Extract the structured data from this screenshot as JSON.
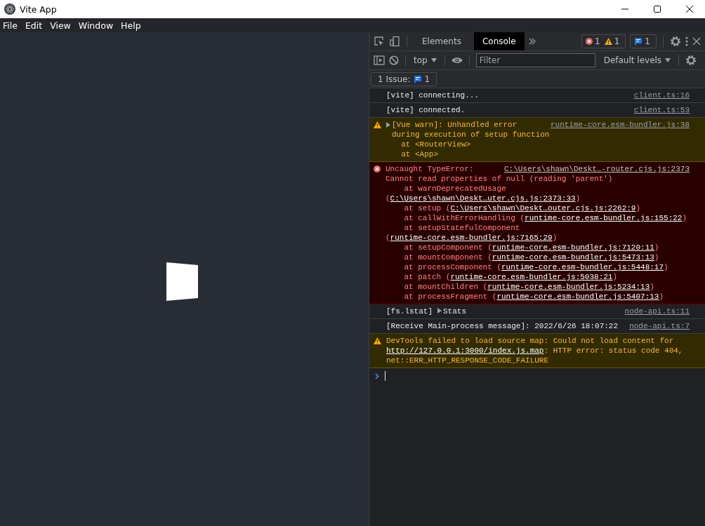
{
  "window": {
    "title": "Vite App"
  },
  "menu": [
    "File",
    "Edit",
    "View",
    "Window",
    "Help"
  ],
  "devtools": {
    "tabs": [
      {
        "label": "Elements",
        "selected": false
      },
      {
        "label": "Console",
        "selected": true
      }
    ],
    "error_count": "1",
    "warning_count": "1",
    "issue_count": "1",
    "context": "top",
    "filter": {
      "placeholder": "Filter"
    },
    "levels": "Default levels",
    "issues": {
      "label": "1 Issue:",
      "count": "1"
    }
  },
  "messages": [
    {
      "kind": "log",
      "text": "[vite] connecting...",
      "source": "client.ts:16"
    },
    {
      "kind": "log",
      "text": "[vite] connected.",
      "source": "client.ts:53"
    },
    {
      "kind": "warn",
      "expandable": true,
      "text": "[Vue warn]: Unhandled error during execution of setup function\n  at <RouterView>\n  at <App>",
      "source": "runtime-core.esm-bundler.js:38"
    },
    {
      "kind": "error",
      "text": "Uncaught TypeError:",
      "detail": "Cannot read properties of null (reading 'parent')",
      "source": "C:\\Users\\shawn\\Deskt…-router.cjs.js:2373",
      "frames": [
        {
          "text": "at warnDeprecatedUsage (",
          "link": "C:\\Users\\shawn\\Deskt…uter.cjs.js:2373:33",
          "tail": ")"
        },
        {
          "text": "at setup (",
          "link": "C:\\Users\\shawn\\Deskt…outer.cjs.js:2262:9",
          "tail": ")"
        },
        {
          "text": "at callWithErrorHandling (",
          "link": "runtime-core.esm-bundler.js:155:22",
          "tail": ")"
        },
        {
          "text": "at setupStatefulComponent (",
          "link": "runtime-core.esm-bundler.js:7165:29",
          "tail": ")"
        },
        {
          "text": "at setupComponent (",
          "link": "runtime-core.esm-bundler.js:7120:11",
          "tail": ")"
        },
        {
          "text": "at mountComponent (",
          "link": "runtime-core.esm-bundler.js:5473:13",
          "tail": ")"
        },
        {
          "text": "at processComponent (",
          "link": "runtime-core.esm-bundler.js:5448:17",
          "tail": ")"
        },
        {
          "text": "at patch (",
          "link": "runtime-core.esm-bundler.js:5038:21",
          "tail": ")"
        },
        {
          "text": "at mountChildren (",
          "link": "runtime-core.esm-bundler.js:5234:13",
          "tail": ")"
        },
        {
          "text": "at processFragment (",
          "link": "runtime-core.esm-bundler.js:5407:13",
          "tail": ")"
        }
      ]
    },
    {
      "kind": "log",
      "text": "[fs.lstat]",
      "object": "Stats",
      "source": "node-api.ts:11"
    },
    {
      "kind": "log",
      "text": "[Receive Main-process message]: 2022/6/26 18:07:22",
      "source": "node-api.ts:7"
    },
    {
      "kind": "warn",
      "text": "DevTools failed to load source map: Could not load content for ",
      "link": "http://127.0.0.1:3000/index.js.map",
      "after": ": HTTP error: status code 404, net::ERR_HTTP_RESPONSE_CODE_FAILURE"
    }
  ]
}
